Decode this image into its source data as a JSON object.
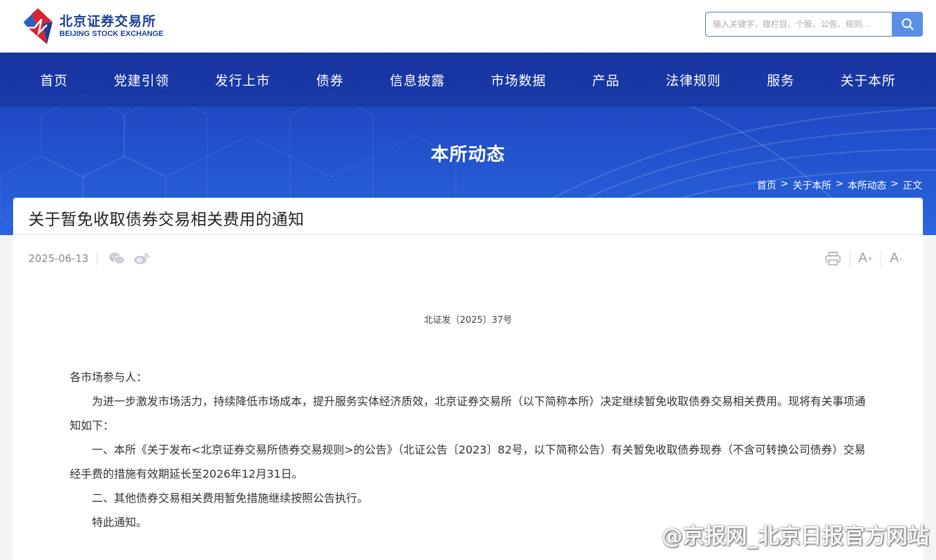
{
  "header": {
    "logo_cn": "北京证券交易所",
    "logo_en": "BEIJING STOCK EXCHANGE",
    "search_placeholder": "输入关键字，搜栏目、个股、公告、规则..."
  },
  "nav": {
    "items": [
      "首页",
      "党建引领",
      "发行上市",
      "债券",
      "信息披露",
      "市场数据",
      "产品",
      "法律规则",
      "服务",
      "关于本所"
    ]
  },
  "banner": {
    "title": "本所动态",
    "breadcrumb": [
      "首页",
      ">",
      "关于本所",
      ">",
      "本所动态",
      ">",
      "正文"
    ]
  },
  "article": {
    "title": "关于暂免收取债券交易相关费用的通知",
    "date": "2025-06-13",
    "doc_number": "北证发〔2025〕37号",
    "salutation": "各市场参与人：",
    "paragraphs": [
      "为进一步激发市场活力，持续降低市场成本，提升服务实体经济质效，北京证券交易所（以下简称本所）决定继续暂免收取债券交易相关费用。现将有关事项通知如下：",
      "一、本所《关于发布<北京证券交易所债券交易规则>的公告》（北证公告〔2023〕82号，以下简称公告）有关暂免收取债券现券（不含可转换公司债券）交易经手费的措施有效期延长至2026年12月31日。",
      "二、其他债券交易相关费用暂免措施继续按照公告执行。",
      "特此通知。"
    ]
  },
  "tools": {
    "font_increase": "A",
    "font_increase_sup": "+",
    "font_decrease": "A",
    "font_decrease_sup": "-"
  },
  "watermark": "@京报网_北京日报官方网站",
  "icons": [
    "logo-mark",
    "search-icon",
    "wechat-icon",
    "weibo-icon",
    "print-icon"
  ],
  "colors": {
    "brand": "#1a3f95",
    "nav_bg": "#1f4cc6",
    "search_btn": "#5b8fe6",
    "logo_red": "#d9232e"
  }
}
